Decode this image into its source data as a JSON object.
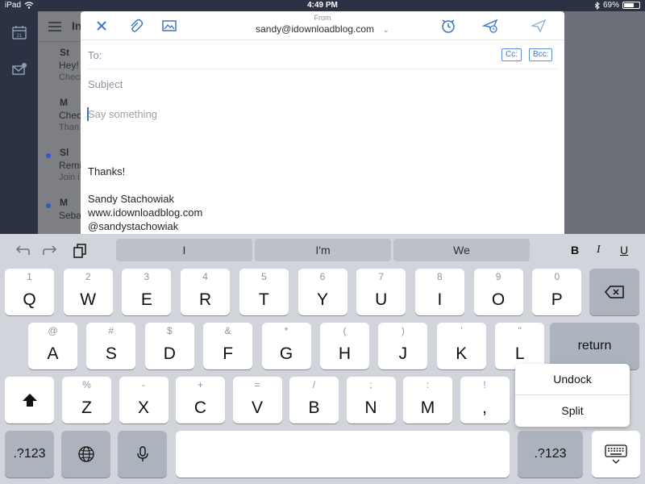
{
  "status_bar": {
    "device": "iPad",
    "time": "4:49 PM",
    "battery_text": "69%",
    "battery_level": 0.69
  },
  "background_app": {
    "inbox_title": "Inbox",
    "items": [
      {
        "sender": "St",
        "subject": "Hey!",
        "preview": "Check",
        "unread": false
      },
      {
        "sender": "M",
        "subject": "Chec",
        "preview": "Than",
        "unread": false
      },
      {
        "sender": "Sl",
        "subject": "Remi",
        "preview": "Join i",
        "unread": true
      },
      {
        "sender": "M",
        "subject": "Seba",
        "preview": "",
        "unread": true
      }
    ],
    "calendar_day": "21"
  },
  "compose": {
    "from_label": "From",
    "from_address": "sandy@idownloadblog.com",
    "to_label": "To:",
    "cc_label": "Cc:",
    "bcc_label": "Bcc:",
    "subject_placeholder": "Subject",
    "body_placeholder": "Say something",
    "signature": {
      "closing": "Thanks!",
      "name": "Sandy Stachowiak",
      "website": "www.idownloadblog.com",
      "handle": "@sandystachowiak"
    },
    "icons": [
      "close-icon",
      "attachment-icon",
      "image-icon",
      "alarm-clock-icon",
      "send-later-icon",
      "send-icon"
    ]
  },
  "keyboard": {
    "suggestions": [
      "I",
      "I'm",
      "We"
    ],
    "format": {
      "bold": "B",
      "italic": "I",
      "underline": "U"
    },
    "row1": [
      {
        "hint": "1",
        "key": "Q"
      },
      {
        "hint": "2",
        "key": "W"
      },
      {
        "hint": "3",
        "key": "E"
      },
      {
        "hint": "4",
        "key": "R"
      },
      {
        "hint": "5",
        "key": "T"
      },
      {
        "hint": "6",
        "key": "Y"
      },
      {
        "hint": "7",
        "key": "U"
      },
      {
        "hint": "8",
        "key": "I"
      },
      {
        "hint": "9",
        "key": "O"
      },
      {
        "hint": "0",
        "key": "P"
      }
    ],
    "row2": [
      {
        "hint": "@",
        "key": "A"
      },
      {
        "hint": "#",
        "key": "S"
      },
      {
        "hint": "$",
        "key": "D"
      },
      {
        "hint": "&",
        "key": "F"
      },
      {
        "hint": "*",
        "key": "G"
      },
      {
        "hint": "(",
        "key": "H"
      },
      {
        "hint": ")",
        "key": "J"
      },
      {
        "hint": "’",
        "key": "K"
      },
      {
        "hint": "\"",
        "key": "L"
      }
    ],
    "row3": [
      {
        "hint": "%",
        "key": "Z"
      },
      {
        "hint": "-",
        "key": "X"
      },
      {
        "hint": "+",
        "key": "C"
      },
      {
        "hint": "=",
        "key": "V"
      },
      {
        "hint": "/",
        "key": "B"
      },
      {
        "hint": ";",
        "key": "N"
      },
      {
        "hint": ":",
        "key": "M"
      },
      {
        "hint": "!",
        "key": ","
      }
    ],
    "return_label": "return",
    "numbers_label": ".?123",
    "popup": [
      "Undock",
      "Split"
    ],
    "colors": {
      "key_light": "#ffffff",
      "key_dark": "#acb3bd",
      "background": "#d1d5db",
      "accent": "#3f74c4"
    }
  }
}
